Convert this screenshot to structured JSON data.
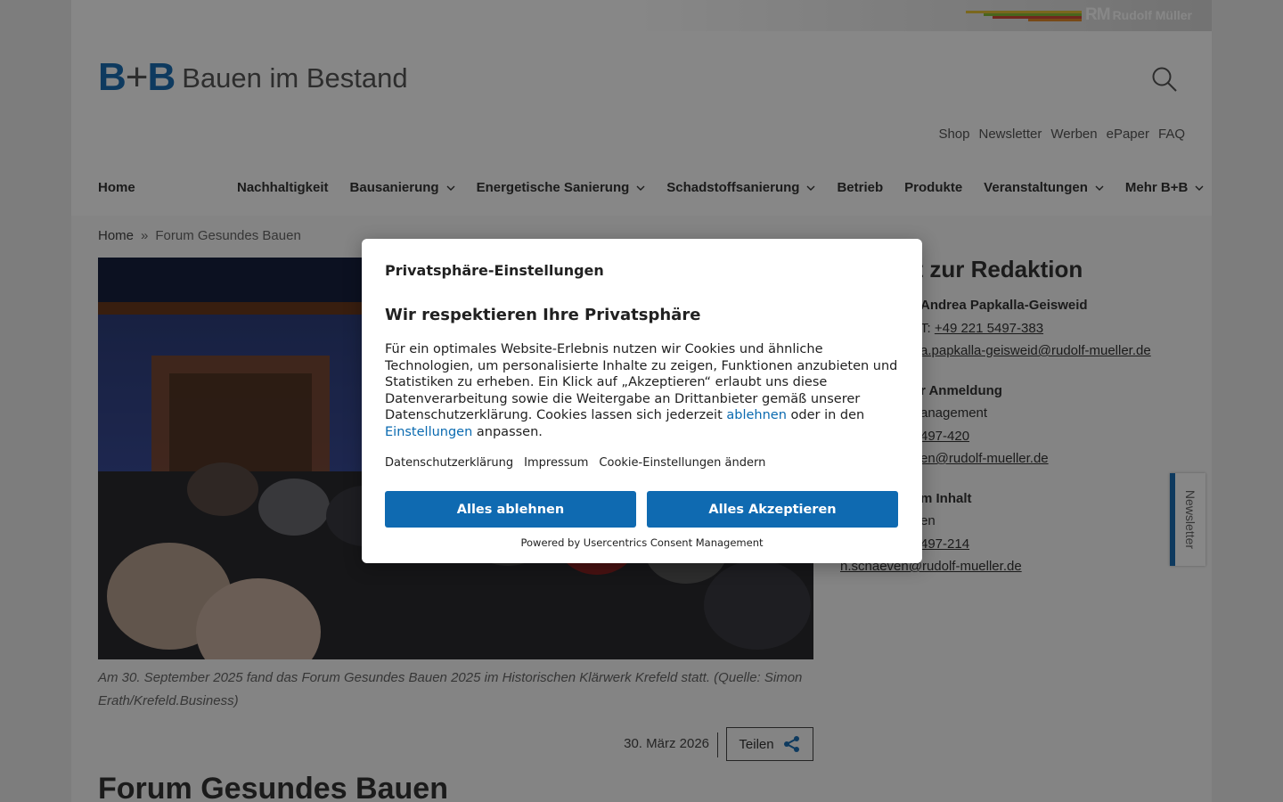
{
  "header": {
    "publisher": "Rudolf Müller",
    "publisher_short": "RM",
    "logo_short_b1": "B",
    "logo_short_plus": "+",
    "logo_short_b2": "B",
    "logo_name": "Bauen im Bestand"
  },
  "utility_links": [
    "Shop",
    "Newsletter",
    "Werben",
    "ePaper",
    "FAQ"
  ],
  "nav": {
    "home": "Home",
    "items": [
      {
        "label": "Nachhaltigkeit",
        "dropdown": false
      },
      {
        "label": "Bausanierung",
        "dropdown": true
      },
      {
        "label": "Energetische Sanierung",
        "dropdown": true
      },
      {
        "label": "Schadstoffsanierung",
        "dropdown": true
      },
      {
        "label": "Betrieb",
        "dropdown": false
      },
      {
        "label": "Produkte",
        "dropdown": false
      },
      {
        "label": "Veranstaltungen",
        "dropdown": true
      },
      {
        "label": "Mehr B+B",
        "dropdown": true
      }
    ]
  },
  "breadcrumb": {
    "home": "Home",
    "sep": "»",
    "current": "Forum Gesundes Bauen"
  },
  "article": {
    "caption": "Am 30. September 2025 fand das Forum Gesundes Bauen 2025 im Historischen Klärwerk Krefeld statt. (Quelle: Simon Erath/Krefeld.Business)",
    "date": "30. März 2026",
    "share": "Teilen",
    "title": "Forum Gesundes Bauen"
  },
  "sidebar": {
    "title_visible": "kt zur Redaktion",
    "l1": "Andrea Papkalla-Geisweid",
    "l2_prefix": "T: ",
    "l2_link": "+49 221 5497-383",
    "l3": "a.papkalla-geisweid@rudolf-mueller.de",
    "l4": "r Anmeldung",
    "l5": "anagement",
    "l6": "497-420",
    "l7": "en@rudolf-mueller.de",
    "l8": "m Inhalt",
    "l9": "en",
    "l10": "497-214",
    "l11": "n.schaeven@rudolf-mueller.de"
  },
  "newsletter_tab": "Newsletter",
  "consent": {
    "heading": "Privatsphäre-Einstellungen",
    "subheading": "Wir respektieren Ihre Privatsphäre",
    "body_1": "Für ein optimales Website-Erlebnis nutzen wir Cookies und ähnliche Technologien, um personalisierte Inhalte zu zeigen, Funktionen anzubieten und Statistiken zu erheben. Ein Klick auf „Akzeptieren“ erlaubt uns diese Datenverarbeitung sowie die Weitergabe an Drittanbieter gemäß unserer Datenschutzerklärung. Cookies lassen sich jederzeit ",
    "link_reject": "ablehnen",
    "body_2": " oder in den ",
    "link_settings": "Einstellungen",
    "body_3": " anpassen.",
    "links": [
      "Datenschutzerklärung",
      "Impressum",
      "Cookie-Einstellungen ändern"
    ],
    "btn_reject": "Alles ablehnen",
    "btn_accept": "Alles Akzeptieren",
    "powered": "Powered by Usercentrics Consent Management"
  }
}
